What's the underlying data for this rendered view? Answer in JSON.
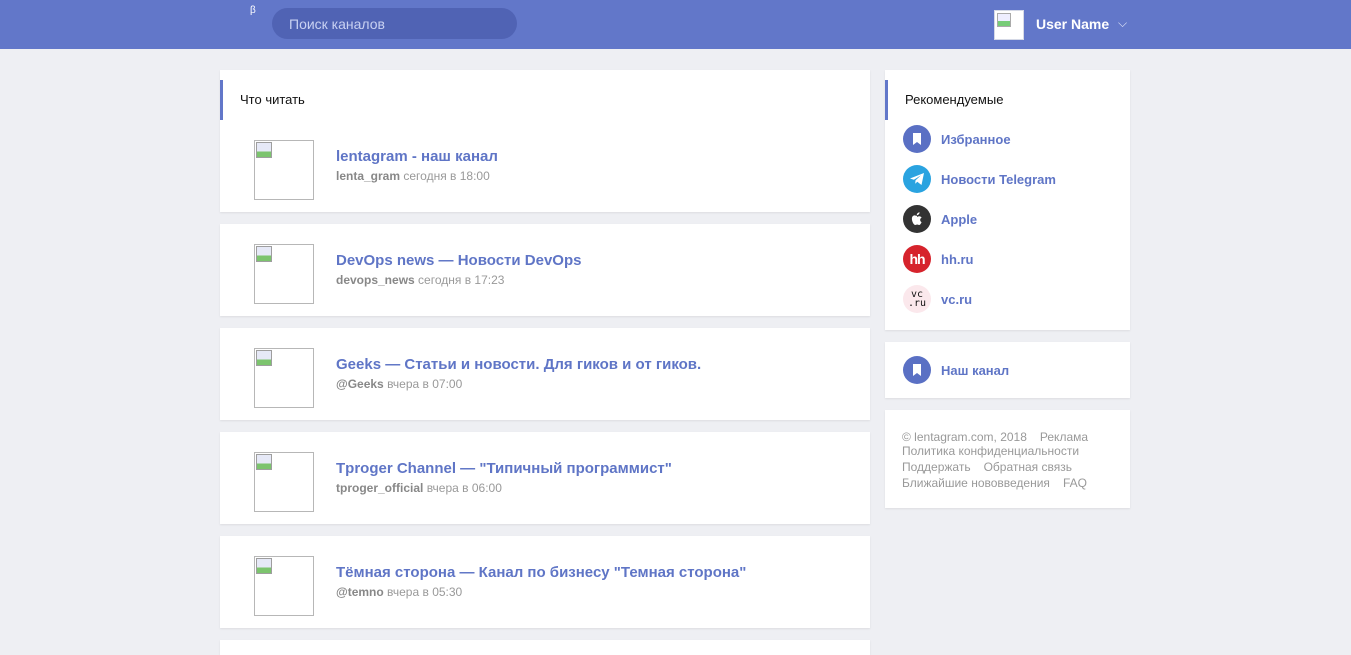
{
  "header": {
    "beta": "β",
    "search_placeholder": "Поиск каналов",
    "user_name": "User Name",
    "chevron": "⌵"
  },
  "feed": {
    "section_title": "Что читать",
    "posts": [
      {
        "title": "lentagram - наш канал",
        "handle": "lenta_gram",
        "time": "сегодня в 18:00"
      },
      {
        "title": "DevOps news — Новости DevOps",
        "handle": "devops_news",
        "time": "сегодня в 17:23"
      },
      {
        "title": "Geeks — Статьи и новости. Для гиков и от гиков.",
        "handle": "@Geeks",
        "time": "вчера в 07:00"
      },
      {
        "title": "Tproger Channel — \"Типичный программист\"",
        "handle": "tproger_official",
        "time": "вчера в 06:00"
      },
      {
        "title": "Тёмная сторона — Канал по бизнесу \"Темная сторона\"",
        "handle": "@temno",
        "time": "вчера в 05:30"
      }
    ]
  },
  "recommended": {
    "section_title": "Рекомендуемые",
    "items": [
      {
        "label": "Избранное",
        "icon": "bookmark-icon",
        "color": "#5a70c4"
      },
      {
        "label": "Новости Telegram",
        "icon": "telegram-icon",
        "color": "#2aa3e0"
      },
      {
        "label": "Apple",
        "icon": "apple-icon",
        "color": "#333333"
      },
      {
        "label": "hh.ru",
        "icon": "hh-logo-icon",
        "color": "#d6232c",
        "logo_text": "hh"
      },
      {
        "label": "vc.ru",
        "icon": "vc-logo-icon",
        "color": "#fbe8ec",
        "logo_text": "vc\n.ru"
      }
    ]
  },
  "our_channel": {
    "label": "Наш канал",
    "icon": "bookmark-icon",
    "color": "#5a70c4"
  },
  "footer": {
    "copyright": "© lentagram.com, 2018",
    "ads": "Реклама",
    "privacy": "Политика конфиденциальности",
    "support": "Поддержать",
    "feedback": "Обратная связь",
    "changes": "Ближайшие нововведения",
    "faq": "FAQ"
  },
  "colors": {
    "accent": "#6277c9",
    "link": "#5f75c6",
    "background": "#eeeff3"
  }
}
